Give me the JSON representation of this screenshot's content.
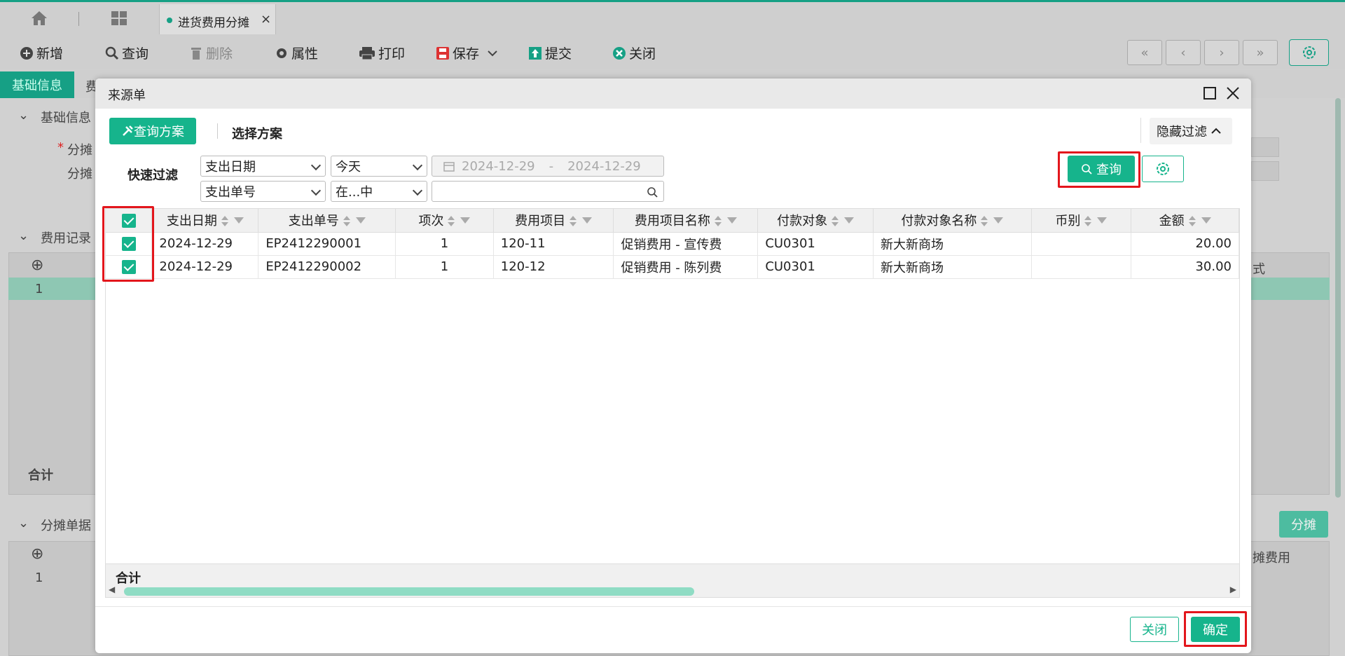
{
  "app": {
    "tab_title": "进货费用分摊",
    "tab_close": "×"
  },
  "toolbar": {
    "add": "新增",
    "query": "查询",
    "delete": "删除",
    "attributes": "属性",
    "print": "打印",
    "save": "保存",
    "submit": "提交",
    "close": "关闭"
  },
  "nav": {
    "first": "«",
    "prev": "‹",
    "next": "›",
    "last": "»"
  },
  "background": {
    "subtab_basic": "基础信息",
    "subtab_fee": "费",
    "section_basic": "基础信息",
    "field_alloc1": "分摊",
    "field_alloc2": "分摊",
    "section_fee": "费用记录",
    "section_alloc": "分摊单据",
    "row_no": "1",
    "total": "合计",
    "fee_col_partial": "式",
    "alloc_col_partial": "摊费用",
    "alloc_button": "分摊",
    "required_mark": "*"
  },
  "modal": {
    "title": "来源单",
    "query_scheme": "查询方案",
    "select_scheme": "选择方案",
    "hide_filter": "隐藏过滤",
    "quick_filter": "快速过滤",
    "filter1": {
      "field": "支出日期",
      "operator": "今天",
      "date_from": "2024-12-29",
      "date_sep": "-",
      "date_to": "2024-12-29"
    },
    "filter2": {
      "field": "支出单号",
      "operator": "在...中",
      "value": ""
    },
    "query_button": "查询",
    "columns": [
      "支出日期",
      "支出单号",
      "项次",
      "费用项目",
      "费用项目名称",
      "付款对象",
      "付款对象名称",
      "币别",
      "金额"
    ],
    "rows": [
      {
        "date": "2024-12-29",
        "no": "EP2412290001",
        "seq": "1",
        "item": "120-11",
        "item_name": "促销费用 - 宣传费",
        "payee": "CU0301",
        "payee_name": "新大新商场",
        "currency": "",
        "amount": "20.00",
        "checked": true
      },
      {
        "date": "2024-12-29",
        "no": "EP2412290002",
        "seq": "1",
        "item": "120-12",
        "item_name": "促销费用 - 陈列费",
        "payee": "CU0301",
        "payee_name": "新大新商场",
        "currency": "",
        "amount": "30.00",
        "checked": true
      }
    ],
    "footer_total": "合计",
    "close_button": "关闭",
    "confirm_button": "确定"
  },
  "colors": {
    "accent": "#16b48c",
    "highlight": "#e3161c"
  }
}
